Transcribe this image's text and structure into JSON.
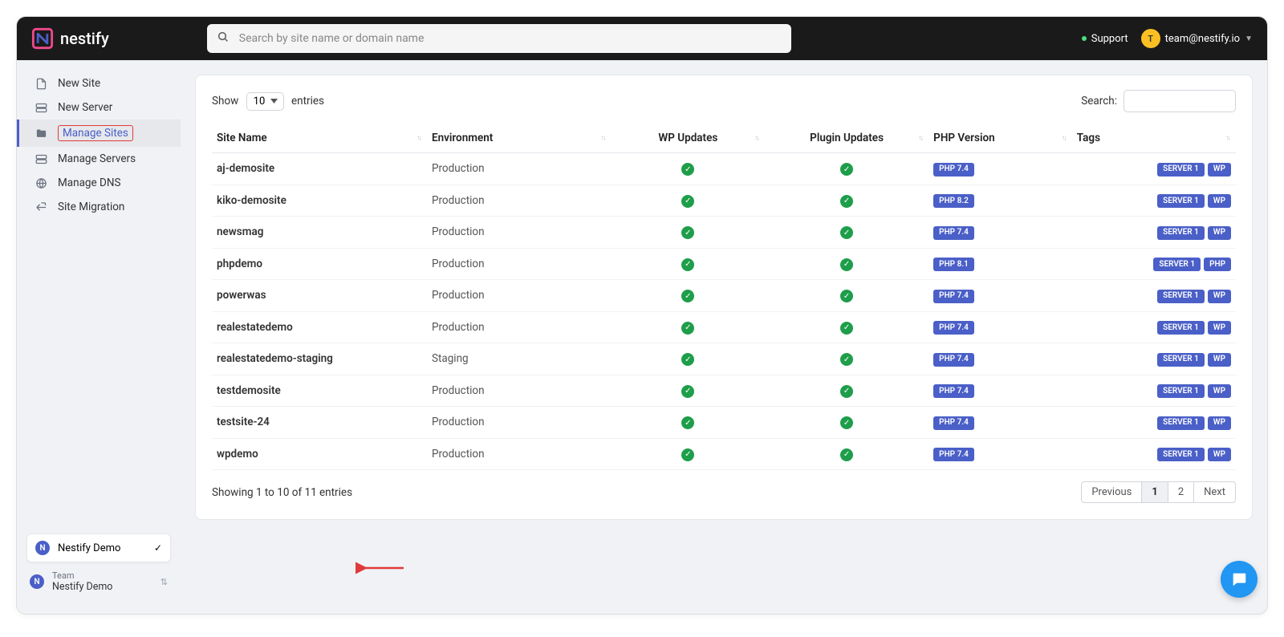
{
  "brand": "nestify",
  "search": {
    "placeholder": "Search by site name or domain name"
  },
  "topbar": {
    "support": "Support",
    "avatar_letter": "T",
    "email": "team@nestify.io"
  },
  "sidebar": {
    "items": [
      {
        "label": "New Site"
      },
      {
        "label": "New Server"
      },
      {
        "label": "Manage Sites"
      },
      {
        "label": "Manage Servers"
      },
      {
        "label": "Manage DNS"
      },
      {
        "label": "Site Migration"
      }
    ]
  },
  "sidebar_footer": {
    "dropdown_label": "Nestify Demo",
    "team_label": "Team",
    "team_name": "Nestify Demo",
    "badge": "N"
  },
  "table_top": {
    "show_label": "Show",
    "entries_label": "entries",
    "entries_value": "10",
    "search_label": "Search:"
  },
  "columns": {
    "site": "Site Name",
    "env": "Environment",
    "wp": "WP Updates",
    "plugin": "Plugin Updates",
    "php": "PHP Version",
    "tags": "Tags"
  },
  "rows": [
    {
      "site": "aj-demosite",
      "env": "Production",
      "php": "PHP 7.4",
      "tags": [
        "SERVER 1",
        "WP"
      ]
    },
    {
      "site": "kiko-demosite",
      "env": "Production",
      "php": "PHP 8.2",
      "tags": [
        "SERVER 1",
        "WP"
      ]
    },
    {
      "site": "newsmag",
      "env": "Production",
      "php": "PHP 7.4",
      "tags": [
        "SERVER 1",
        "WP"
      ]
    },
    {
      "site": "phpdemo",
      "env": "Production",
      "php": "PHP 8.1",
      "tags": [
        "SERVER 1",
        "PHP"
      ]
    },
    {
      "site": "powerwas",
      "env": "Production",
      "php": "PHP 7.4",
      "tags": [
        "SERVER 1",
        "WP"
      ]
    },
    {
      "site": "realestatedemo",
      "env": "Production",
      "php": "PHP 7.4",
      "tags": [
        "SERVER 1",
        "WP"
      ]
    },
    {
      "site": "realestatedemo-staging",
      "env": "Staging",
      "php": "PHP 7.4",
      "tags": [
        "SERVER 1",
        "WP"
      ]
    },
    {
      "site": "testdemosite",
      "env": "Production",
      "php": "PHP 7.4",
      "tags": [
        "SERVER 1",
        "WP"
      ]
    },
    {
      "site": "testsite-24",
      "env": "Production",
      "php": "PHP 7.4",
      "tags": [
        "SERVER 1",
        "WP"
      ]
    },
    {
      "site": "wpdemo",
      "env": "Production",
      "php": "PHP 7.4",
      "tags": [
        "SERVER 1",
        "WP"
      ]
    }
  ],
  "table_bottom": {
    "info": "Showing 1 to 10 of 11 entries",
    "prev": "Previous",
    "next": "Next",
    "pages": [
      "1",
      "2"
    ]
  }
}
